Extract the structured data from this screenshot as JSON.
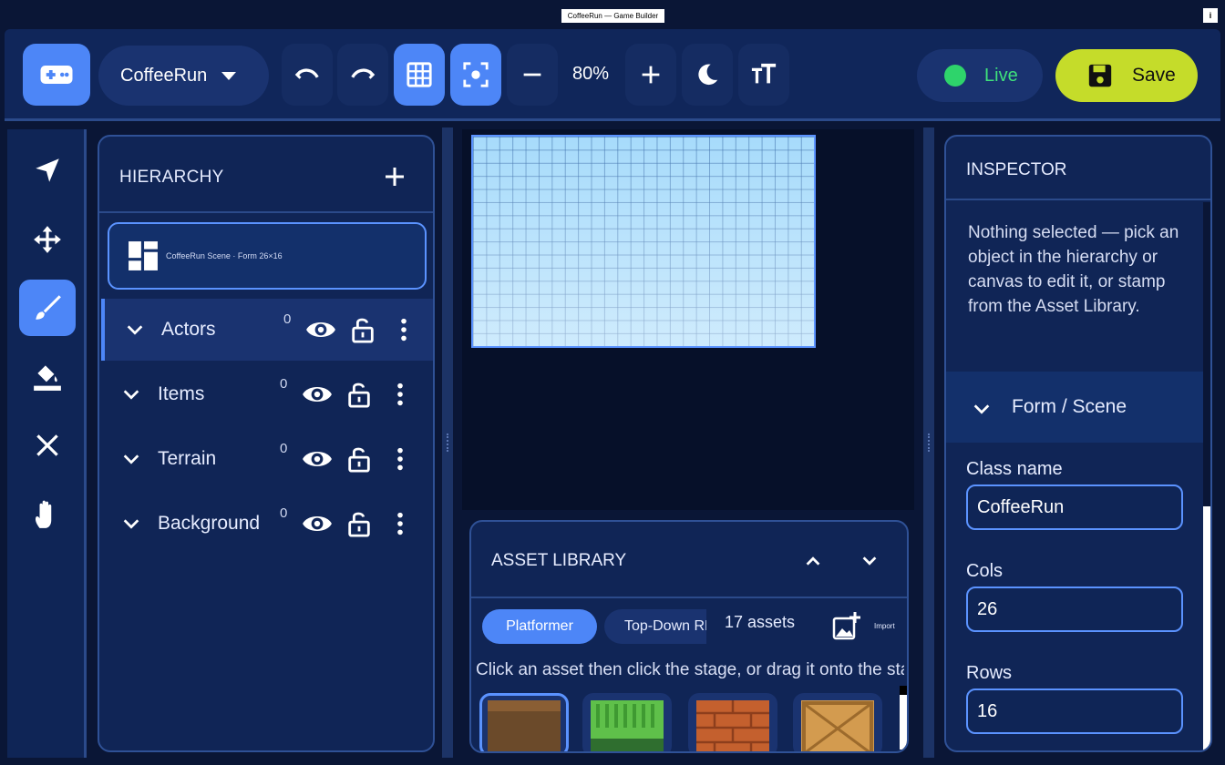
{
  "window": {
    "title": "CoffeeRun — Game Builder",
    "info_icon": "info-icon"
  },
  "toolbar": {
    "project_name": "CoffeeRun",
    "zoom": "80%",
    "live_label": "Live",
    "save_label": "Save",
    "icons": [
      "gamepad-icon",
      "undo-icon",
      "redo-icon",
      "grid-icon",
      "focus-icon",
      "zoom-out-icon",
      "zoom-in-icon",
      "moon-icon",
      "text-size-icon",
      "save-icon"
    ]
  },
  "tools": [
    "select-arrow-icon",
    "move-icon",
    "brush-icon",
    "fill-bucket-icon",
    "erase-x-icon",
    "hand-pan-icon"
  ],
  "hierarchy": {
    "title": "HIERARCHY",
    "scene": {
      "label": "CoffeeRun Scene · Form 26×16"
    },
    "layers": [
      {
        "name": "Actors",
        "count": "0"
      },
      {
        "name": "Items",
        "count": "0"
      },
      {
        "name": "Terrain",
        "count": "0"
      },
      {
        "name": "Background",
        "count": "0"
      }
    ]
  },
  "asset_library": {
    "title": "ASSET LIBRARY",
    "tabs": [
      "Platformer",
      "Top-Down RPG"
    ],
    "count": "17 assets",
    "import_label": "Import",
    "hint": "Click an asset then click the stage, or drag it onto the stage.",
    "tiles": [
      "dirt-tile",
      "grass-tile",
      "brick-tile",
      "crate-tile"
    ]
  },
  "inspector": {
    "title": "INSPECTOR",
    "message": "Nothing selected — pick an object in the hierarchy or canvas to edit it, or stamp from the Asset Library.",
    "section": "Form / Scene",
    "fields": {
      "class_name": {
        "label": "Class name",
        "value": "CoffeeRun"
      },
      "cols": {
        "label": "Cols",
        "value": "26"
      },
      "rows": {
        "label": "Rows",
        "value": "16"
      }
    }
  },
  "colors": {
    "accent": "#4d86f7",
    "live": "#2ed46b",
    "save": "#c5dc2a",
    "panel": "#102556",
    "background": "#0a1636"
  }
}
